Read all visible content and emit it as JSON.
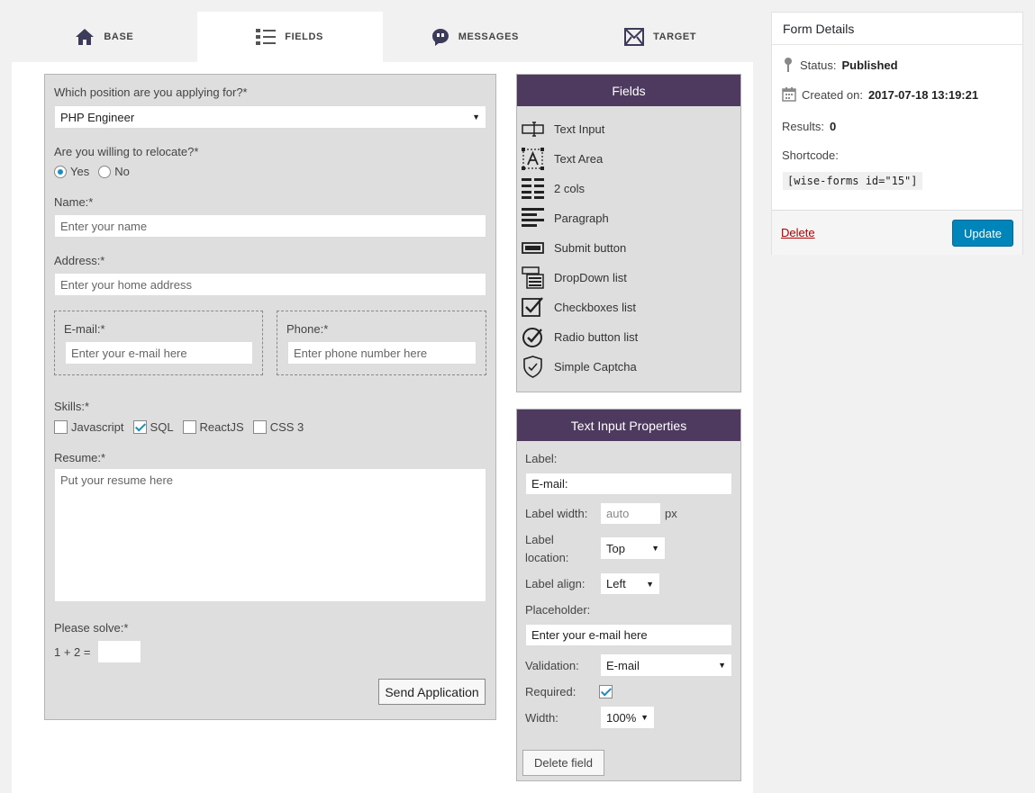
{
  "tabs": [
    {
      "label": "BASE",
      "icon": "home-icon"
    },
    {
      "label": "FIELDS",
      "icon": "list-icon"
    },
    {
      "label": "MESSAGES",
      "icon": "chat-icon"
    },
    {
      "label": "TARGET",
      "icon": "envelope-icon"
    }
  ],
  "preview": {
    "position_label": "Which position are you applying for?*",
    "position_value": "PHP Engineer",
    "relocate_label": "Are you willing to relocate?*",
    "relocate_yes": "Yes",
    "relocate_no": "No",
    "name_label": "Name:*",
    "name_placeholder": "Enter your name",
    "address_label": "Address:*",
    "address_placeholder": "Enter your home address",
    "email_label": "E-mail:*",
    "email_placeholder": "Enter your e-mail here",
    "phone_label": "Phone:*",
    "phone_placeholder": "Enter phone number here",
    "skills_label": "Skills:*",
    "skills": [
      {
        "label": "Javascript",
        "checked": false
      },
      {
        "label": "SQL",
        "checked": true
      },
      {
        "label": "ReactJS",
        "checked": false
      },
      {
        "label": "CSS 3",
        "checked": false
      }
    ],
    "resume_label": "Resume:*",
    "resume_placeholder": "Put your resume here",
    "captcha_label": "Please solve:*",
    "captcha_question": "1 + 2 =",
    "submit_label": "Send Application"
  },
  "fields_panel": {
    "title": "Fields",
    "items": [
      {
        "label": "Text Input",
        "icon": "text-input-icon"
      },
      {
        "label": "Text Area",
        "icon": "text-area-icon"
      },
      {
        "label": "2 cols",
        "icon": "two-cols-icon"
      },
      {
        "label": "Paragraph",
        "icon": "paragraph-icon"
      },
      {
        "label": "Submit button",
        "icon": "submit-button-icon"
      },
      {
        "label": "DropDown list",
        "icon": "dropdown-icon"
      },
      {
        "label": "Checkboxes list",
        "icon": "checkbox-icon"
      },
      {
        "label": "Radio button list",
        "icon": "radio-icon"
      },
      {
        "label": "Simple Captcha",
        "icon": "shield-icon"
      }
    ]
  },
  "properties": {
    "title": "Text Input Properties",
    "label_label": "Label:",
    "label_value": "E-mail:",
    "label_width_label": "Label width:",
    "label_width_value": "auto",
    "label_width_unit": "px",
    "label_location_label_1": "Label",
    "label_location_label_2": "location:",
    "label_location_value": "Top",
    "label_align_label": "Label align:",
    "label_align_value": "Left",
    "placeholder_label": "Placeholder:",
    "placeholder_value": "Enter your e-mail here",
    "validation_label": "Validation:",
    "validation_value": "E-mail",
    "required_label": "Required:",
    "required_checked": true,
    "width_label": "Width:",
    "width_value": "100%",
    "delete_label": "Delete field"
  },
  "sidebar": {
    "title": "Form Details",
    "status_label": "Status:",
    "status_value": "Published",
    "created_label": "Created on:",
    "created_value": "2017-07-18 13:19:21",
    "results_label": "Results:",
    "results_value": "0",
    "shortcode_label": "Shortcode:",
    "shortcode_value": "[wise-forms id=\"15\"]",
    "delete_label": "Delete",
    "update_label": "Update"
  }
}
